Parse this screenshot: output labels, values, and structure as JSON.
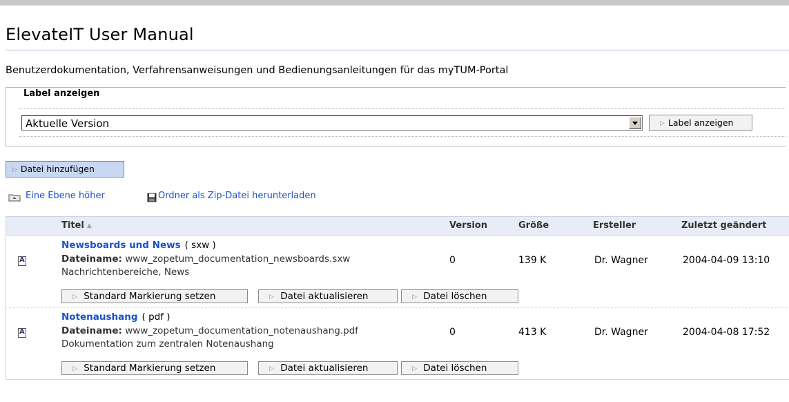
{
  "page": {
    "title": "ElevateIT User Manual",
    "description": "Benutzerdokumentation, Verfahrensanweisungen und Bedienungsanleitungen für das myTUM-Portal"
  },
  "label_section": {
    "legend": "Label anzeigen",
    "selected_option": "Aktuelle Version",
    "button_label": "Label anzeigen"
  },
  "toolbar": {
    "add_file_label": "Datei hinzufügen",
    "up_level_label": "Eine Ebene höher",
    "zip_download_label": "Ordner als Zip-Datei herunterladen"
  },
  "table": {
    "columns": {
      "title": "Titel",
      "version": "Version",
      "size": "Größe",
      "creator": "Ersteller",
      "modified": "Zuletzt geändert"
    },
    "filename_prefix": "Dateiname:",
    "rows": [
      {
        "title": "Newsboards und News",
        "type": "( sxw )",
        "filename": "www_zopetum_documentation_newsboards.sxw",
        "description": "Nachrichtenbereiche, News",
        "version": "0",
        "size": "139 K",
        "creator": "Dr. Wagner",
        "modified": "2004-04-09 13:10"
      },
      {
        "title": "Notenaushang",
        "type": "( pdf )",
        "filename": "www_zopetum_documentation_notenaushang.pdf",
        "description": "Dokumentation zum zentralen Notenaushang",
        "version": "0",
        "size": "413 K",
        "creator": "Dr. Wagner",
        "modified": "2004-04-08 17:52"
      }
    ],
    "row_actions": {
      "set_marker": "Standard Markierung setzen",
      "update_file": "Datei aktualisieren",
      "delete_file": "Datei löschen"
    }
  }
}
